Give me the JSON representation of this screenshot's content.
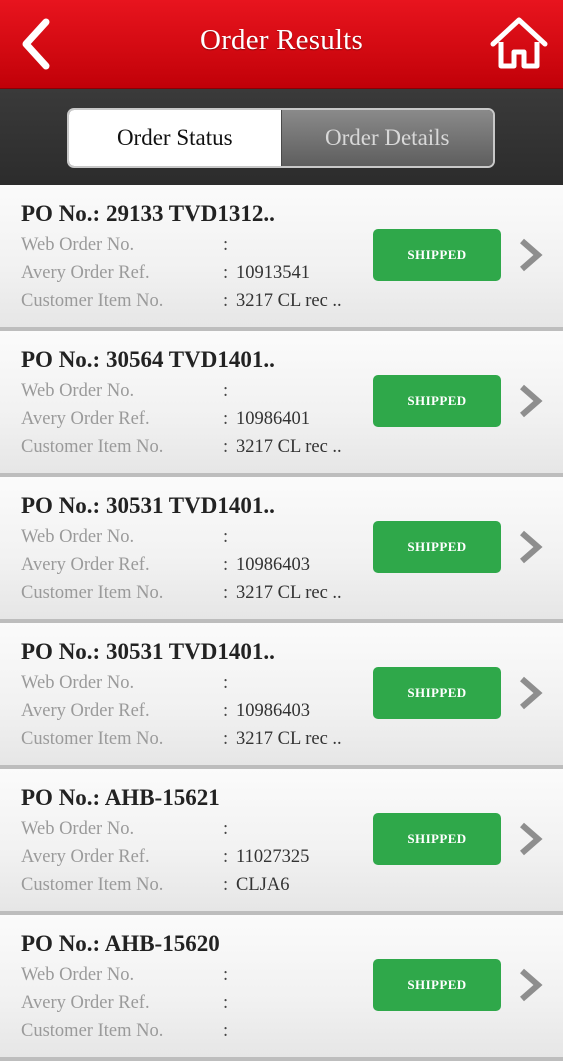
{
  "header": {
    "title": "Order Results",
    "back_icon": "back-chevron-icon",
    "home_icon": "home-icon",
    "color": "#d30a12"
  },
  "tabs": [
    {
      "label": "Order Status",
      "active": true
    },
    {
      "label": "Order Details",
      "active": false
    }
  ],
  "labels": {
    "web_order": "Web Order No.",
    "avery_ref": "Avery Order Ref.",
    "customer_item": "Customer Item No.",
    "colon": ":"
  },
  "status_color": "#2fa84a",
  "orders": [
    {
      "po": "PO No.: 29133 TVD1312..",
      "web_order": "",
      "avery_ref": "10913541",
      "customer_item": "3217 CL rec ..",
      "status": "SHIPPED"
    },
    {
      "po": "PO No.: 30564 TVD1401..",
      "web_order": "",
      "avery_ref": "10986401",
      "customer_item": "3217 CL rec ..",
      "status": "SHIPPED"
    },
    {
      "po": "PO No.: 30531 TVD1401..",
      "web_order": "",
      "avery_ref": "10986403",
      "customer_item": "3217 CL rec ..",
      "status": "SHIPPED"
    },
    {
      "po": "PO No.: 30531 TVD1401..",
      "web_order": "",
      "avery_ref": "10986403",
      "customer_item": "3217 CL rec ..",
      "status": "SHIPPED"
    },
    {
      "po": "PO No.: AHB-15621",
      "web_order": "",
      "avery_ref": "11027325",
      "customer_item": "CLJA6",
      "status": "SHIPPED"
    },
    {
      "po": "PO No.: AHB-15620",
      "web_order": "",
      "avery_ref": "",
      "customer_item": "",
      "status": "SHIPPED"
    }
  ]
}
